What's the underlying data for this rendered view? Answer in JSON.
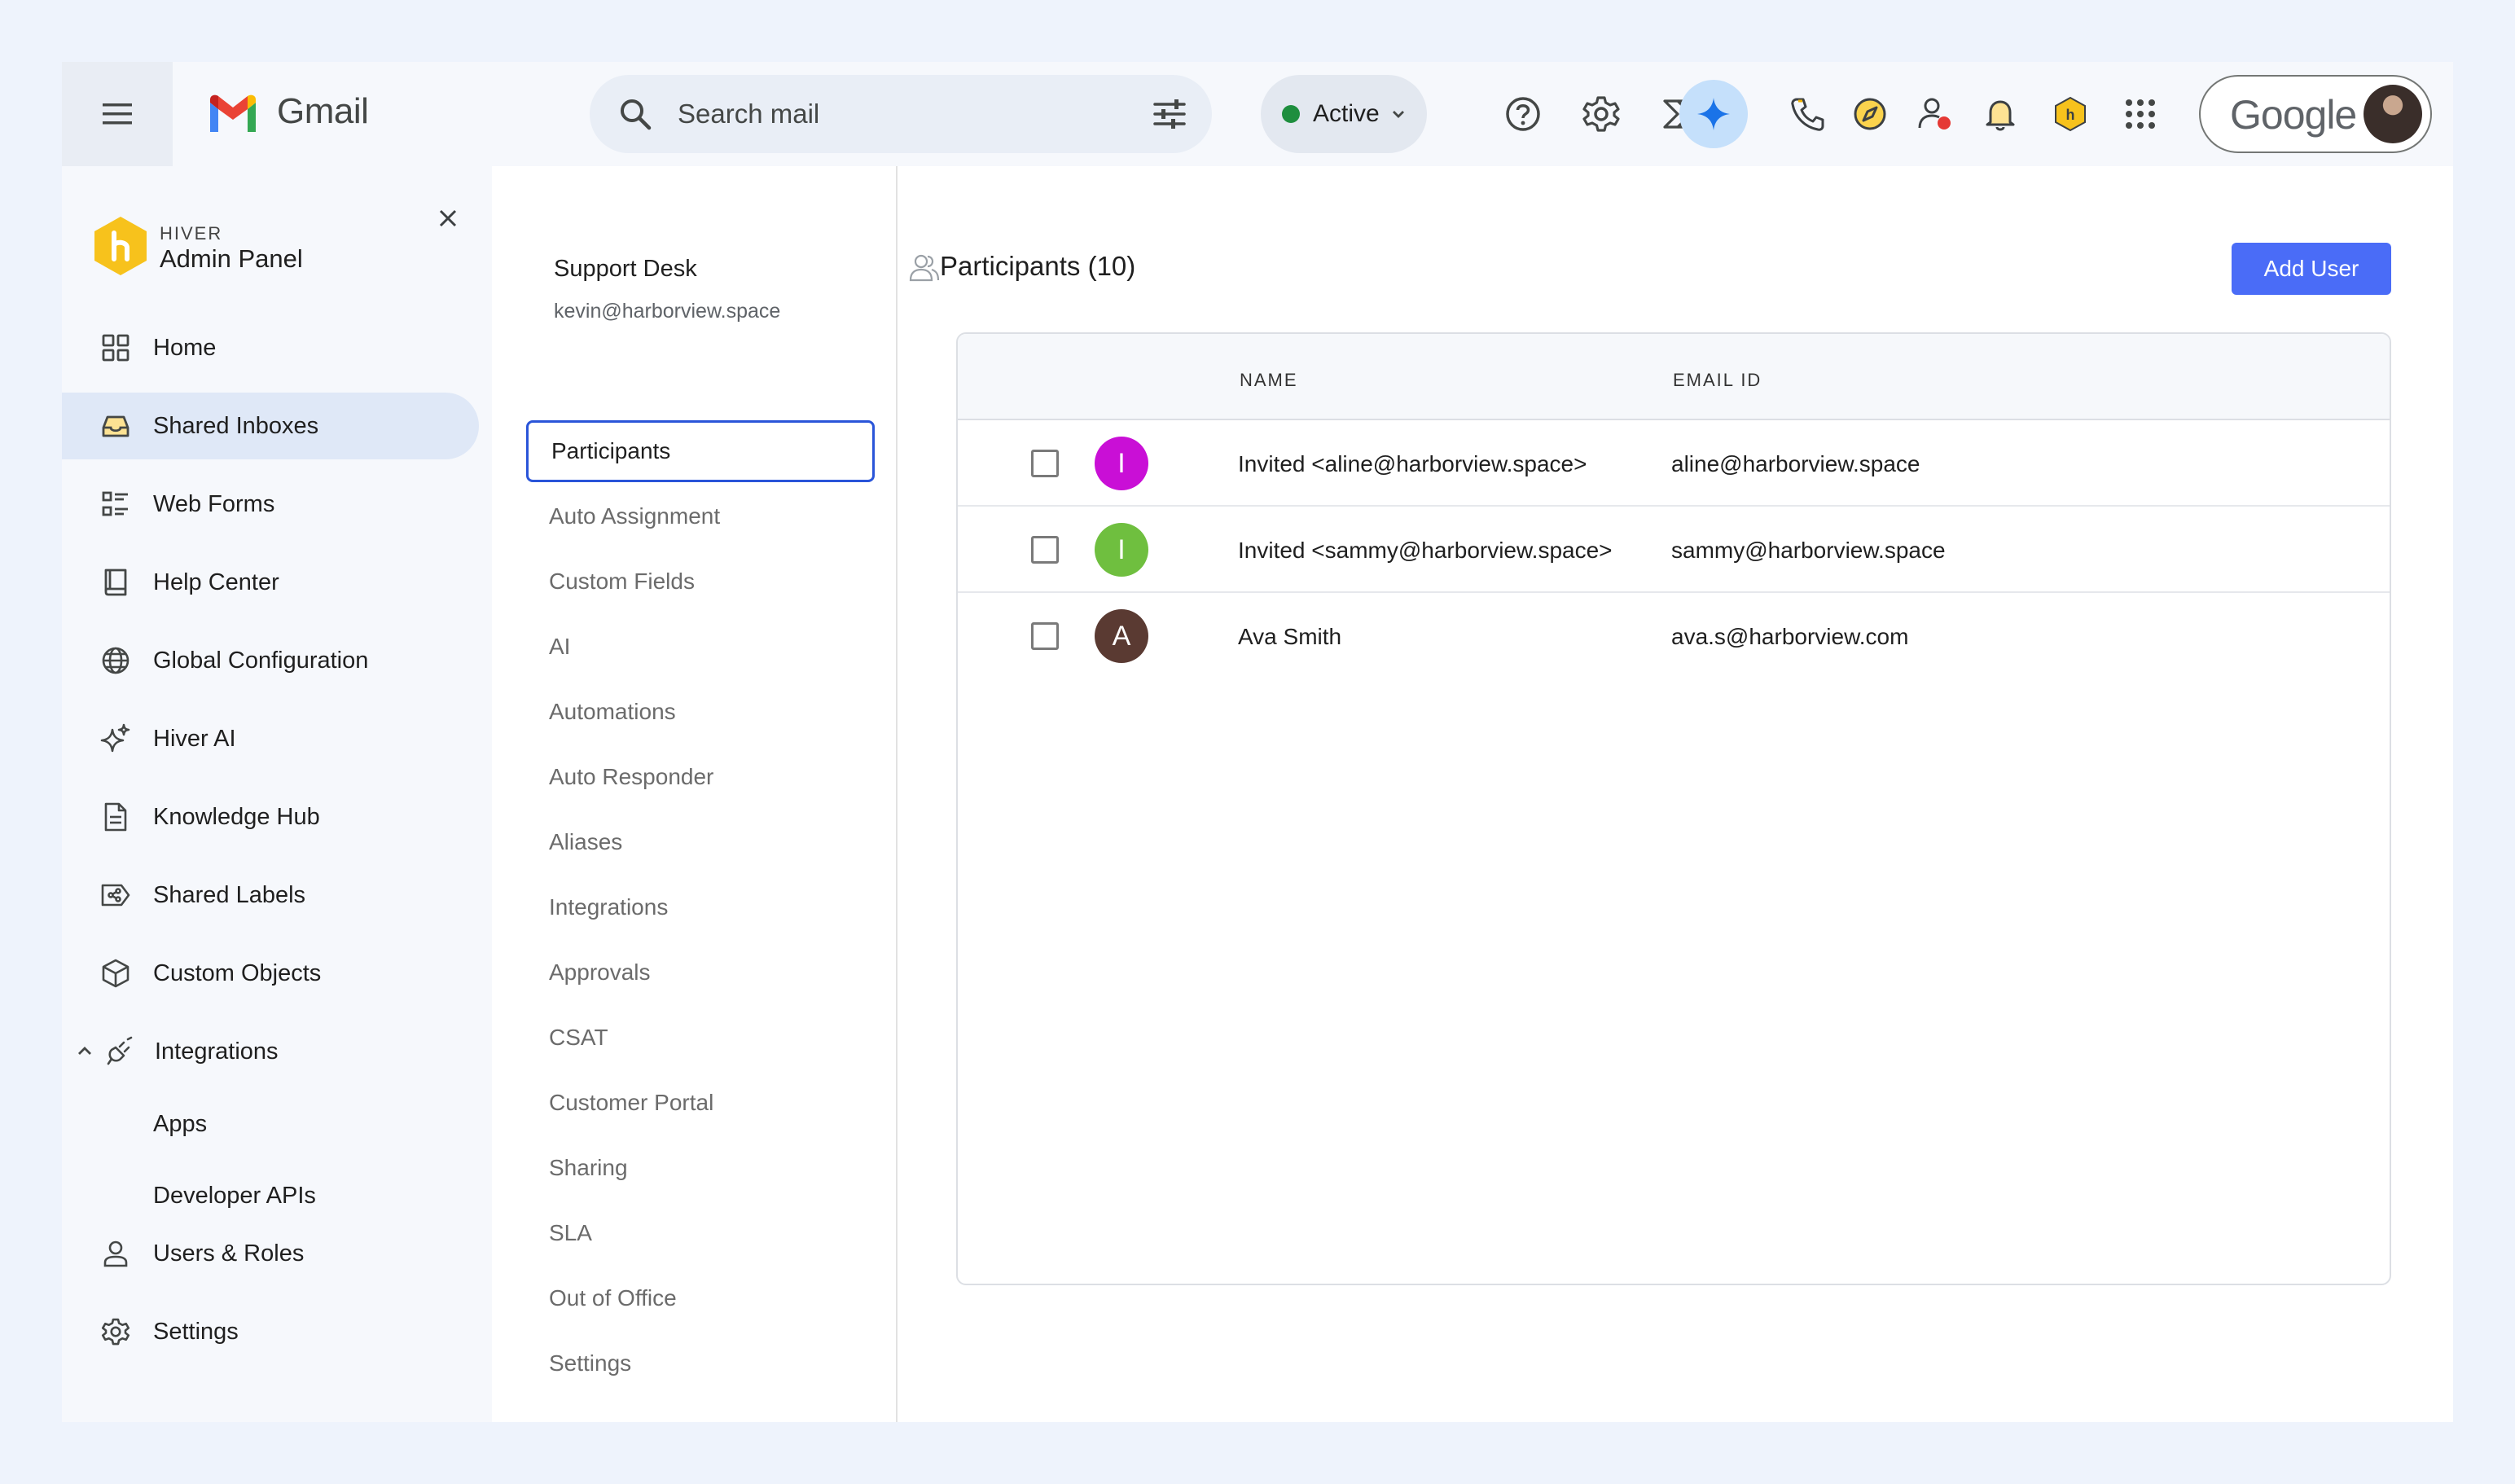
{
  "gmail": {
    "brand": "Gmail",
    "search_placeholder": "Search mail",
    "status": "Active",
    "account_brand": "Google"
  },
  "sidebar": {
    "brand_small": "HIVER",
    "brand_title": "Admin Panel",
    "items": [
      {
        "label": "Home",
        "icon": "grid-icon"
      },
      {
        "label": "Shared Inboxes",
        "icon": "inbox-icon",
        "active": true
      },
      {
        "label": "Web Forms",
        "icon": "form-list-icon"
      },
      {
        "label": "Help Center",
        "icon": "book-icon"
      },
      {
        "label": "Global Configuration",
        "icon": "globe-icon"
      },
      {
        "label": "Hiver AI",
        "icon": "sparkle-icon"
      },
      {
        "label": "Knowledge Hub",
        "icon": "document-icon"
      },
      {
        "label": "Shared Labels",
        "icon": "label-share-icon"
      },
      {
        "label": "Custom Objects",
        "icon": "cube-icon"
      },
      {
        "label": "Integrations",
        "icon": "plug-icon",
        "expanded": true
      },
      {
        "label": "Users & Roles",
        "icon": "user-icon"
      },
      {
        "label": "Settings",
        "icon": "gear-icon"
      }
    ],
    "sub_items": [
      "Apps",
      "Developer APIs"
    ]
  },
  "inbox": {
    "name": "Support Desk",
    "email": "kevin@harborview.space"
  },
  "settings_nav": [
    "Participants",
    "Auto Assignment",
    "Custom Fields",
    "AI",
    "Automations",
    "Auto Responder",
    "Aliases",
    "Integrations",
    "Approvals",
    "CSAT",
    "Customer Portal",
    "Sharing",
    "SLA",
    "Out of Office",
    "Settings"
  ],
  "main": {
    "title": "Participants (10)",
    "add_user_label": "Add User",
    "columns": [
      "NAME",
      "EMAIL ID"
    ],
    "rows": [
      {
        "initial": "I",
        "color": "#c90fd6",
        "name": "Invited <aline@harborview.space>",
        "email": "aline@harborview.space",
        "checked": false
      },
      {
        "initial": "I",
        "color": "#6fbf3f",
        "name": "Invited <sammy@harborview.space>",
        "email": "sammy@harborview.space",
        "checked": false
      },
      {
        "initial": "A",
        "color": "#5a3a32",
        "name": "Ava Smith",
        "email": "ava.s@harborview.com",
        "checked": false
      }
    ]
  },
  "colors": {
    "accent": "#4a6cf7",
    "active_outline": "#2a55d9",
    "sidebar_active": "#dfe8f7",
    "online": "#1e8e3e"
  }
}
